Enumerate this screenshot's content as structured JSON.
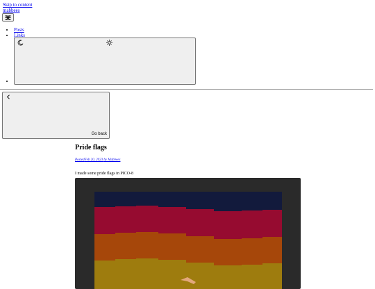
{
  "skip_link": "Skip to content",
  "site_title": "mabbees",
  "menu_icon": "hamburger-menu-icon",
  "nav": {
    "items": [
      {
        "label": "Posts"
      },
      {
        "label": "Links"
      }
    ]
  },
  "theme_toggle": {
    "dark_icon": "moon-icon",
    "light_icon": "sun-icon"
  },
  "back": {
    "icon": "chevron-left-icon",
    "label": "Go back"
  },
  "post": {
    "title": "Pride flags",
    "posted_prefix": "Posted",
    "date": "Feb 20, 2023",
    "by": "by Mabbees",
    "description": "I made some pride flags in PICO-8"
  },
  "colors": {
    "media_background": "#2a2a2a",
    "flag_stripes": [
      "#121a3c",
      "#960b30",
      "#a6470a",
      "#9e7c0e"
    ],
    "link": "#0000ee"
  }
}
